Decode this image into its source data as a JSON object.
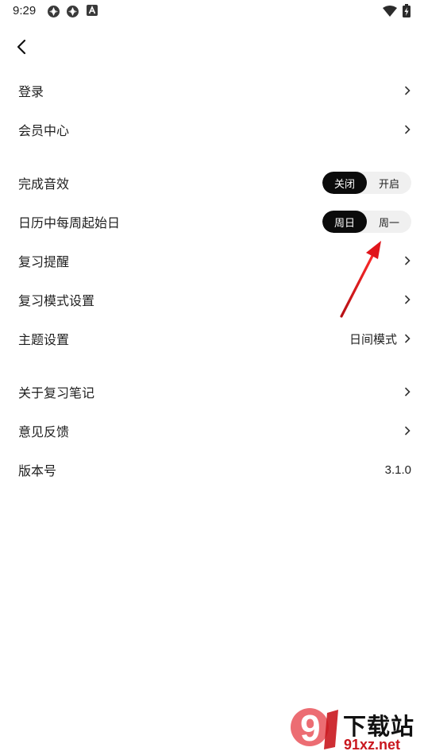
{
  "status_bar": {
    "time": "9:29",
    "icons": [
      "sync-icon",
      "sync-icon",
      "a-badge-icon",
      "wifi-icon",
      "battery-charging-icon"
    ]
  },
  "header": {
    "back_icon": "chevron-left-icon"
  },
  "settings": {
    "login": "登录",
    "membership": "会员中心",
    "completion_sound": {
      "label": "完成音效",
      "options": [
        "关闭",
        "开启"
      ],
      "selected": "关闭"
    },
    "week_start": {
      "label": "日历中每周起始日",
      "options": [
        "周日",
        "周一"
      ],
      "selected": "周日"
    },
    "review_reminder": "复习提醒",
    "review_mode": "复习模式设置",
    "theme": {
      "label": "主题设置",
      "value": "日间模式"
    },
    "about": "关于复习笔记",
    "feedback": "意见反馈",
    "version": {
      "label": "版本号",
      "value": "3.1.0"
    }
  },
  "watermark": {
    "line1": "下载站",
    "line2": "91xz.net",
    "logo_glyph": "9"
  },
  "colors": {
    "active_segment": "#0b0b0b",
    "segment_bg": "#f0f0f0",
    "arrow": "#e0151b",
    "watermark_red": "#c9171e"
  }
}
